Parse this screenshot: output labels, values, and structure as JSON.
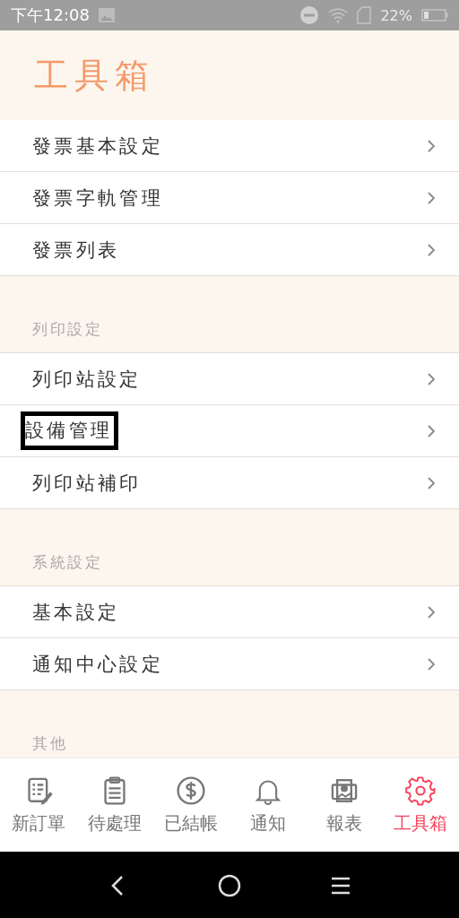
{
  "status_bar": {
    "time": "下午12:08",
    "battery": "22%"
  },
  "header": {
    "title": "工具箱"
  },
  "sections": [
    {
      "items": [
        {
          "label": "發票基本設定",
          "highlighted": false
        },
        {
          "label": "發票字軌管理",
          "highlighted": false
        },
        {
          "label": "發票列表",
          "highlighted": false
        }
      ]
    },
    {
      "title": "列印設定",
      "items": [
        {
          "label": "列印站設定",
          "highlighted": false
        },
        {
          "label": "設備管理",
          "highlighted": true
        },
        {
          "label": "列印站補印",
          "highlighted": false
        }
      ]
    },
    {
      "title": "系統設定",
      "items": [
        {
          "label": "基本設定",
          "highlighted": false
        },
        {
          "label": "通知中心設定",
          "highlighted": false
        }
      ]
    },
    {
      "title": "其他"
    }
  ],
  "tab_bar": [
    {
      "label": "新訂單",
      "selected": false
    },
    {
      "label": "待處理",
      "selected": false
    },
    {
      "label": "已結帳",
      "selected": false
    },
    {
      "label": "通知",
      "selected": false
    },
    {
      "label": "報表",
      "selected": false
    },
    {
      "label": "工具箱",
      "selected": true
    }
  ]
}
